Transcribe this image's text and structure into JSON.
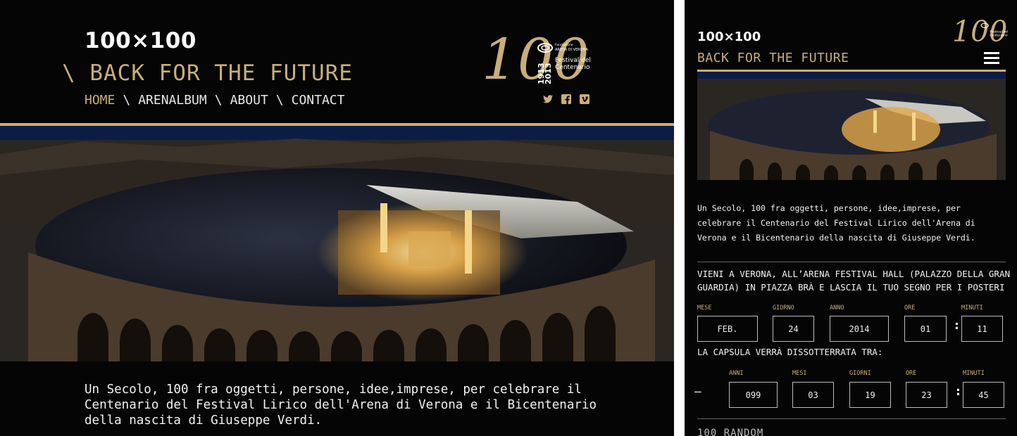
{
  "desktop": {
    "brand": "100×100",
    "tagline": "\\ BACK FOR THE FUTURE",
    "nav": [
      {
        "label": "HOME",
        "active": true
      },
      {
        "label": "ARENALBUM",
        "active": false
      },
      {
        "label": "ABOUT",
        "active": false
      },
      {
        "label": "CONTACT",
        "active": false
      }
    ],
    "nav_separator": "\\",
    "logo": {
      "number": "100",
      "years_top": "1913",
      "years_bottom": "2013",
      "foundation_label": "Fondazione",
      "foundation_name": "ARENA DI VERONA",
      "festival_line1": "Festival del",
      "festival_line2": "Centenario"
    },
    "social_icons": [
      "twitter-icon",
      "facebook-icon",
      "vimeo-icon"
    ],
    "intro_text": "Un Secolo, 100 fra oggetti, persone, idee,imprese, per celebrare il Centenario del Festival Lirico dell'Arena di Verona e il Bicentenario della nascita di Giuseppe Verdi."
  },
  "mobile": {
    "brand": "100×100",
    "tagline": "BACK FOR THE FUTURE",
    "intro_text": "Un Secolo, 100 fra oggetti, persone, idee,imprese, per celebrare il Centenario del Festival Lirico dell'Arena di Verona e il Bicentenario della nascita di Giuseppe Verdi.",
    "invite_text": "VIENI A VERONA, ALL’ARENA FESTIVAL HALL (PALAZZO DELLA GRAN GUARDIA) IN PIAZZA BRÀ E LASCIA IL TUO SEGNO PER I POSTERI",
    "date_fields": {
      "mese_label": "MESE",
      "mese_value": "FEB.",
      "giorno_label": "GIORNO",
      "giorno_value": "24",
      "anno_label": "ANNO",
      "anno_value": "2014",
      "ore_label": "ORE",
      "ore_value": "01",
      "minuti_label": "MINUTI",
      "minuti_value": "11"
    },
    "countdown_title": "LA CAPSULA VERRÀ DISSOTTERRATA TRA:",
    "countdown_sign": "–",
    "countdown": {
      "anni_label": "ANNI",
      "anni_value": "099",
      "mesi_label": "MESI",
      "mesi_value": "03",
      "giorni_label": "GIORNI",
      "giorni_value": "19",
      "ore_label": "ORE",
      "ore_value": "23",
      "minuti_label": "MINUTI",
      "minuti_value": "45"
    },
    "colon": ":",
    "section_heading": "100 RANDOM"
  },
  "colors": {
    "gold": "#c9ae7a",
    "background": "#050505",
    "text": "#f2f2f2"
  }
}
